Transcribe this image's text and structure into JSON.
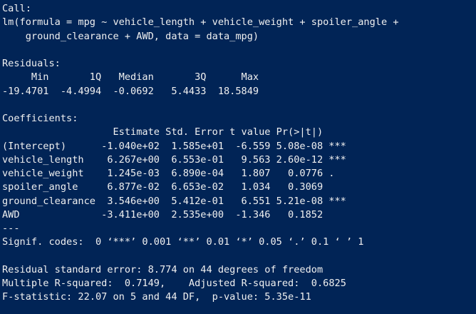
{
  "console": {
    "background": "#012456",
    "text_color": "#f0f0f0",
    "call": {
      "header": "Call:",
      "line1": "lm(formula = mpg ~ vehicle_length + vehicle_weight + spoiler_angle +",
      "line2": "    ground_clearance + AWD, data = data_mpg)"
    },
    "residuals": {
      "header": "Residuals:",
      "columns_line": "     Min       1Q   Median       3Q      Max ",
      "values_line": "-19.4701  -4.4994  -0.0692   5.4433  18.5849 "
    },
    "coefficients": {
      "header": "Coefficients:",
      "columns_line": "                   Estimate Std. Error t value Pr(>|t|)    ",
      "rows": [
        "(Intercept)      -1.040e+02  1.585e+01  -6.559 5.08e-08 ***",
        "vehicle_length    6.267e+00  6.553e-01   9.563 2.60e-12 ***",
        "vehicle_weight    1.245e-03  6.890e-04   1.807   0.0776 .  ",
        "spoiler_angle     6.877e-02  6.653e-02   1.034   0.3069    ",
        "ground_clearance  3.546e+00  5.412e-01   6.551 5.21e-08 ***",
        "AWD              -3.411e+00  2.535e+00  -1.346   0.1852    "
      ],
      "separator": "---",
      "signif_codes": "Signif. codes:  0 ‘***’ 0.001 ‘**’ 0.01 ‘*’ 0.05 ‘.’ 0.1 ‘ ’ 1"
    },
    "summary": {
      "residual_se": "Residual standard error: 8.774 on 44 degrees of freedom",
      "r_squared": "Multiple R-squared:  0.7149,\tAdjusted R-squared:  0.6825 ",
      "f_statistic": "F-statistic: 22.07 on 5 and 44 DF,  p-value: 5.35e-11"
    }
  }
}
